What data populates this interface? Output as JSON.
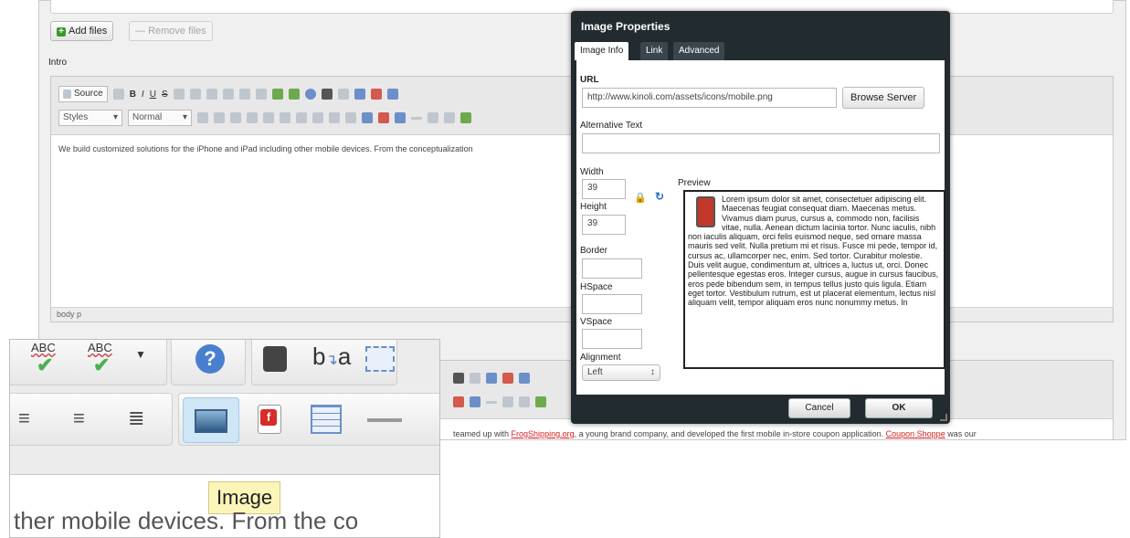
{
  "window": {
    "add_files": "Add files",
    "remove_files": "Remove files",
    "intro_label": "Intro",
    "body_text": "We build customized solutions for the iPhone and iPad including other mobile devices. From the conceptualization",
    "statusbar": "body  p",
    "lower_text_prefix": "teamed up with ",
    "lower_link1": "FrogShipping.org",
    "lower_text_mid": ", a young brand company, and developed the first mobile in-store coupon application. ",
    "lower_link2": "Coupon Shoppe",
    "lower_text_suffix": " was our"
  },
  "toolbar": {
    "source": "Source",
    "styles": "Styles",
    "format": "Normal",
    "accent": "#6d8fc8"
  },
  "dialog": {
    "title": "Image Properties",
    "tabs": [
      "Image Info",
      "Link",
      "Advanced"
    ],
    "url_label": "URL",
    "url_value": "http://www.kinoli.com/assets/icons/mobile.png",
    "browse_button": "Browse Server",
    "alt_label": "Alternative Text",
    "alt_value": "",
    "width_label": "Width",
    "width_value": "39",
    "height_label": "Height",
    "height_value": "39",
    "border_label": "Border",
    "hspace_label": "HSpace",
    "vspace_label": "VSpace",
    "alignment_label": "Alignment",
    "alignment_value": "Left",
    "preview_label": "Preview",
    "preview_text": "Lorem ipsum dolor sit amet, consectetuer adipiscing elit. Maecenas feugiat consequat diam. Maecenas metus. Vivamus diam purus, cursus a, commodo non, facilisis vitae, nulla. Aenean dictum lacinia tortor. Nunc iaculis, nibh non iaculis aliquam, orci felis euismod neque, sed ornare massa mauris sed velit. Nulla pretium mi et risus. Fusce mi pede, tempor id, cursus ac, ullamcorper nec, enim. Sed tortor. Curabitur molestie. Duis velit augue, condimentum at, ultrices a, luctus ut, orci. Donec pellentesque egestas eros. Integer cursus, augue in cursus faucibus, eros pede bibendum sem, in tempus tellus justo quis ligula. Etiam eget tortor. Vestibulum rutrum, est ut placerat elementum, lectus nisl aliquam velit, tempor aliquam eros nunc nonummy metus. In",
    "cancel": "Cancel",
    "ok": "OK"
  },
  "zoom": {
    "tooltip": "Image",
    "text": "ther mobile devices. From the co",
    "spell_label": "ABC",
    "find_label": "b",
    "replace_label": "a"
  },
  "colors": {
    "link_red": "#d81e1e",
    "dialog_bg": "#222b30",
    "tooltip_bg": "#fbf5b8"
  }
}
